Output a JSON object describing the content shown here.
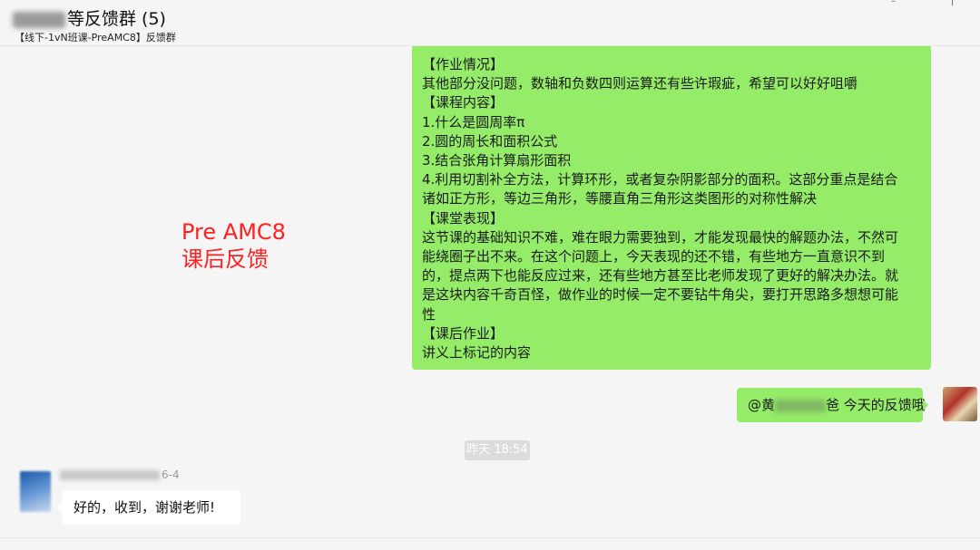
{
  "header": {
    "title_suffix": "等反馈群 (5)",
    "subtitle": "【线下-1vN班课-PreAMC8】反馈群"
  },
  "side_label": {
    "line1": "Pre AMC8",
    "line2": "课后反馈"
  },
  "message_main": {
    "lines": [
      "【作业情况】",
      "其他部分没问题，数轴和负数四则运算还有些许瑕疵，希望可以好好咀嚼",
      "【课程内容】",
      "1.什么是圆周率π",
      "2.圆的周长和面积公式",
      "3.结合张角计算扇形面积",
      "4.利用切割补全方法，计算环形，或者复杂阴影部分的面积。这部分重点是结合",
      "诸如正方形，等边三角形，等腰直角三角形这类图形的对称性解决",
      "【课堂表现】",
      "这节课的基础知识不难，难在眼力需要独到，才能发现最快的解题办法，不然可",
      "能绕圈子出不来。在这个问题上，今天表现的还不错，有些地方一直意识不到",
      "的，提点两下也能反应过来，还有些地方甚至比老师发现了更好的解决办法。就",
      "是这块内容千奇百怪，做作业的时候一定不要钻牛角尖，要打开思路多想想可能",
      "性",
      "【课后作业】",
      "讲义上标记的内容"
    ]
  },
  "message_reply": {
    "prefix": "@黄",
    "suffix": "爸 今天的反馈哦"
  },
  "timestamp": "昨天 18:54",
  "incoming": {
    "sender_suffix": "6-4",
    "text": "好的，收到，谢谢老师!"
  }
}
